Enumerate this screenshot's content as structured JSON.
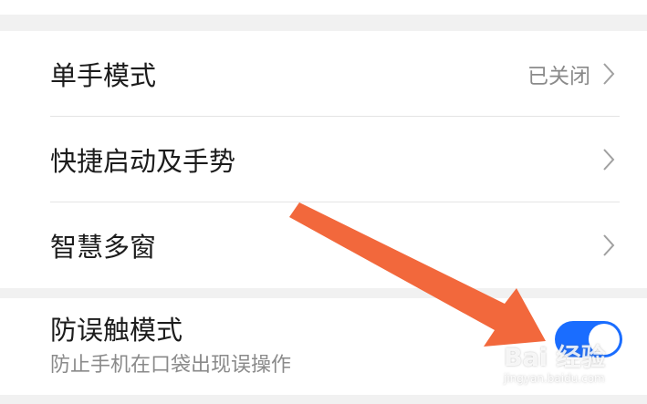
{
  "settings": {
    "items": [
      {
        "label": "单手模式",
        "value": "已关闭"
      },
      {
        "label": "快捷启动及手势",
        "value": ""
      },
      {
        "label": "智慧多窗",
        "value": ""
      }
    ],
    "accidental_touch": {
      "title": "防误触模式",
      "subtitle": "防止手机在口袋出现误操作",
      "toggle_on": true
    }
  },
  "annotation": {
    "arrow_color": "#f2683c",
    "arrow_target": "accidental-touch-toggle"
  },
  "colors": {
    "toggle_on": "#1a6dff",
    "background": "#f1f1f1",
    "card": "#ffffff",
    "primary_text": "#1c1c1c",
    "secondary_text": "#8a8a8a"
  },
  "watermark": {
    "logo_text": "Bai 经验",
    "url": "jingyan.baidu.com"
  }
}
